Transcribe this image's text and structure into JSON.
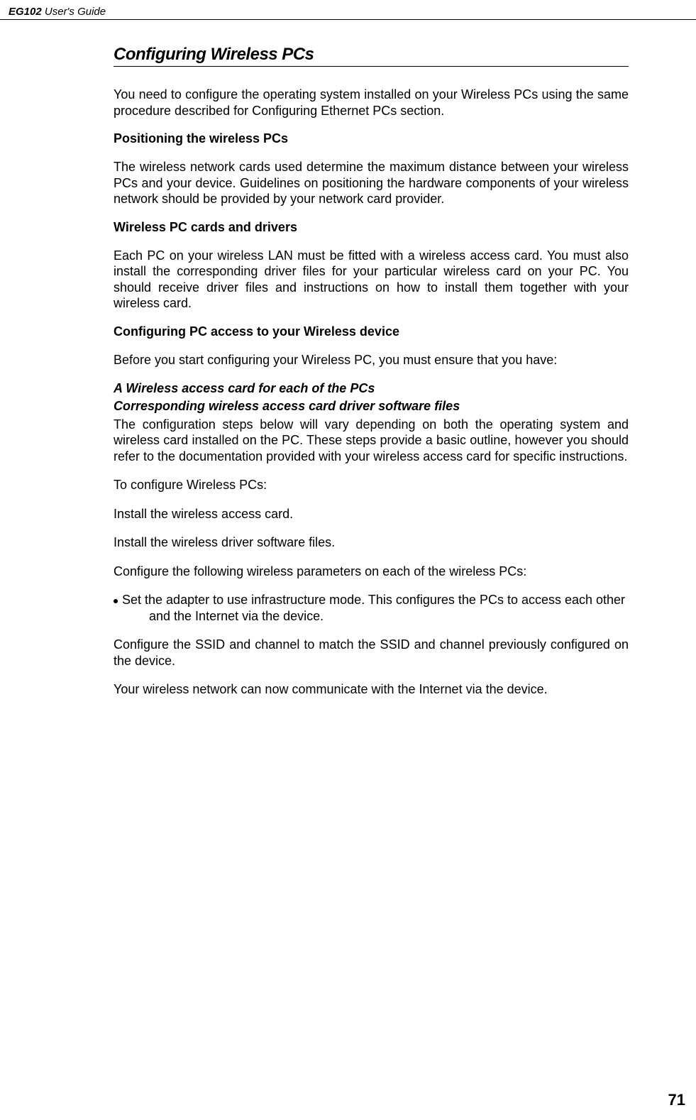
{
  "header": {
    "product": "EG102",
    "subtitle": " User's Guide"
  },
  "sectionTitle": "Configuring Wireless PCs",
  "para1": "You need to configure the operating system installed on your Wireless PCs using the same procedure described for Configuring Ethernet PCs section.",
  "sub1": "Positioning the wireless PCs",
  "para2": "The wireless network cards used determine the maximum distance between your wireless PCs and your device. Guidelines on positioning the hardware components of your wireless network should be provided by your network card provider.",
  "sub2": "Wireless PC cards and drivers",
  "para3": "Each PC on your wireless LAN must be fitted with a wireless access card. You must also install the corresponding driver files for your particular wireless card on your PC. You should receive driver files and instructions on how to install them together with your wireless card.",
  "sub3": "Configuring PC access to your Wireless device",
  "para4": "Before you start configuring your Wireless PC, you must ensure that you have:",
  "ital1": "A Wireless access card for each of the PCs",
  "ital2": "Corresponding wireless access card driver software files",
  "para5": "The configuration steps below will vary depending on both the operating system and wireless card installed on the PC. These steps provide a basic outline, however you should refer to the documentation provided with your wireless access card for specific instructions.",
  "para6": "To configure Wireless PCs:",
  "para7": "Install the wireless access card.",
  "para8": "Install the wireless driver software files.",
  "para9": "Configure the following wireless parameters on each of the wireless PCs:",
  "bullet1": "Set the adapter to use infrastructure mode. This configures the PCs to access each other and the Internet via the device.",
  "para10": "Configure the SSID and channel to match the SSID and channel previously configured on the device.",
  "para11": "Your wireless network can now communicate with the Internet via the device.",
  "pageNumber": "71"
}
